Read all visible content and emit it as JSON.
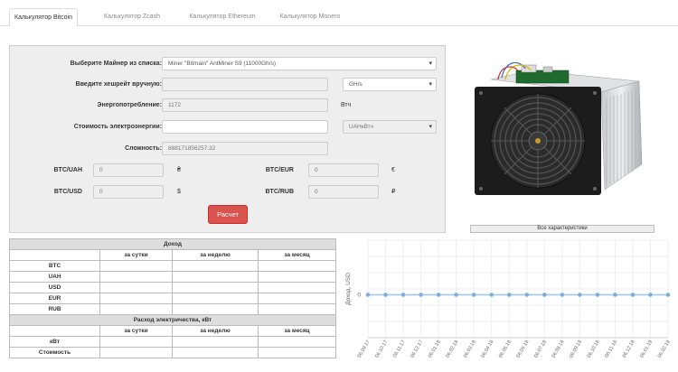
{
  "tabs": [
    {
      "label": "Калькулятор Bitcoin",
      "active": true
    },
    {
      "label": "Калькулятор Zcash",
      "active": false
    },
    {
      "label": "Калькулятор Ethereum",
      "active": false
    },
    {
      "label": "Калькулятор Monero",
      "active": false
    }
  ],
  "form": {
    "miner_label": "Выберите Майнер из списка:",
    "miner_value": "Miner \"Bitmain\" AntMiner S9 (11000Gh/s)",
    "hashrate_label": "Введите хешрейт вручную:",
    "hashrate_value": "",
    "hashrate_unit": "GH/s",
    "power_label": "Энергопотребление:",
    "power_value": "1172",
    "power_unit": "Втч",
    "cost_label": "Стоимость электроэнергии:",
    "cost_value": "",
    "cost_unit": "UAHкВтч",
    "difficulty_label": "Сложность:",
    "difficulty_value": "888171856257.32"
  },
  "rates": {
    "btc_uah_label": "BTC/UAH",
    "btc_uah_value": "0",
    "btc_uah_symbol": "₴",
    "btc_eur_label": "BTC/EUR",
    "btc_eur_value": "0",
    "btc_eur_symbol": "€",
    "btc_usd_label": "BTC/USD",
    "btc_usd_value": "0",
    "btc_usd_symbol": "$",
    "btc_rub_label": "BTC/RUB",
    "btc_rub_value": "0",
    "btc_rub_symbol": "₽"
  },
  "calc_button": "Расчет",
  "specs_button": "Все характеристики",
  "income_table": {
    "title": "Доход",
    "columns": [
      "за сутки",
      "за неделю",
      "за месяц"
    ],
    "rows": [
      "BTC",
      "UAH",
      "USD",
      "EUR",
      "RUB"
    ]
  },
  "power_table": {
    "title": "Расход электричества, кВт",
    "columns": [
      "за сутки",
      "за неделю",
      "за месяц"
    ],
    "rows": [
      "кВт",
      "Стоимость"
    ]
  },
  "chart_data": {
    "type": "line",
    "ylabel": "Доход, USD",
    "y_ticks": [
      "0"
    ],
    "x": [
      "06.09.17",
      "06.10.17",
      "06.11.17",
      "06.12.17",
      "06.01.18",
      "06.02.18",
      "06.03.18",
      "06.04.18",
      "06.05.18",
      "06.06.18",
      "06.07.18",
      "06.08.18",
      "06.09.18",
      "06.10.18",
      "06.11.18",
      "06.12.18",
      "06.01.19",
      "06.02.19"
    ],
    "series": [
      {
        "values": [
          0,
          0,
          0,
          0,
          0,
          0,
          0,
          0,
          0,
          0,
          0,
          0,
          0,
          0,
          0,
          0,
          0,
          0
        ]
      }
    ],
    "grid": true,
    "colors": {
      "line": "#9dc3e6",
      "point": "#7faedb"
    }
  }
}
